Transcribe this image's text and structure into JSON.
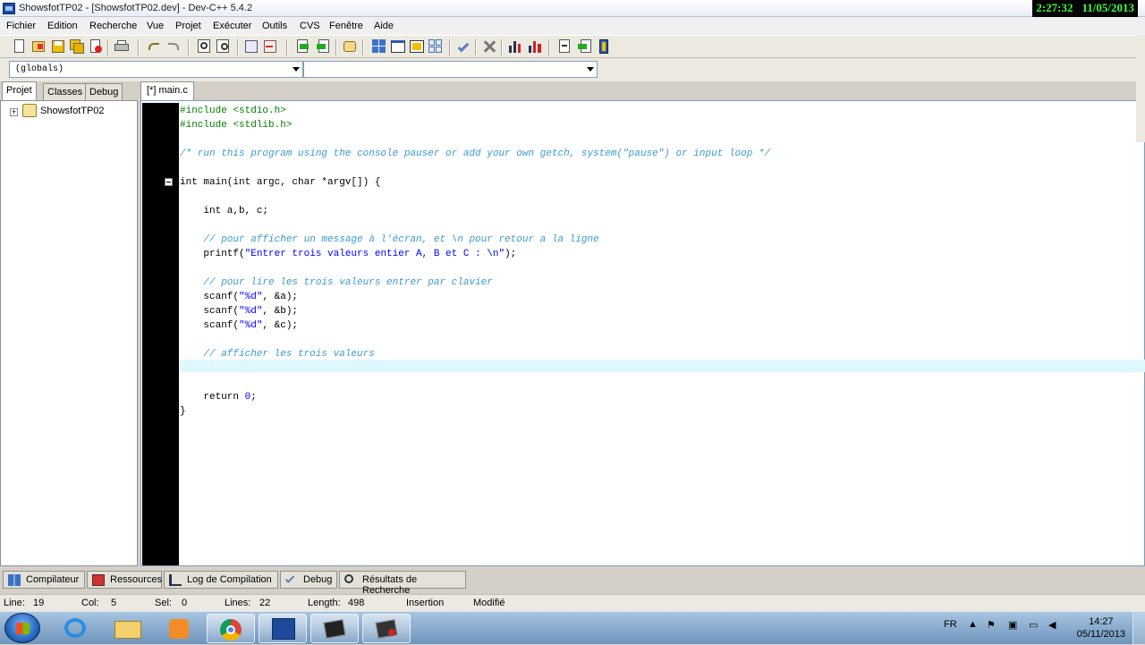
{
  "window": {
    "title": "ShowsfotTP02 - [ShowsfotTP02.dev] - Dev-C++ 5.4.2"
  },
  "clock_overlay": {
    "time": "2:27:32",
    "date": "11/05/2013"
  },
  "menu": [
    "Fichier",
    "Edition",
    "Recherche",
    "Vue",
    "Projet",
    "Exécuter",
    "Outils",
    "CVS",
    "Fenêtre",
    "Aide"
  ],
  "combos": {
    "scope": "(globals)",
    "member": ""
  },
  "left_tabs": [
    "Projet",
    "Classes",
    "Debug"
  ],
  "project_tree": {
    "root": "ShowsfotTP02"
  },
  "editor_tab": "[*] main.c",
  "code": [
    {
      "t": "pp",
      "text": "#include <stdio.h>"
    },
    {
      "t": "pp",
      "text": "#include <stdlib.h>"
    },
    {
      "t": "",
      "text": ""
    },
    {
      "t": "cm",
      "text": "/* run this program using the console pauser or add your own getch, system(\"pause\") or input loop */"
    },
    {
      "t": "",
      "text": ""
    },
    {
      "t": "",
      "text": "int main(int argc, char *argv[]) {"
    },
    {
      "t": "",
      "text": ""
    },
    {
      "t": "",
      "text": "    int a,b, c;"
    },
    {
      "t": "",
      "text": ""
    },
    {
      "t": "cm",
      "text": "    // pour afficher un message à l'écran, et \\n pour retour a la ligne"
    },
    {
      "t": "str",
      "pre": "    printf(",
      "s": "\"Entrer trois valeurs entier A, B et C : \\n\"",
      "post": ");"
    },
    {
      "t": "",
      "text": ""
    },
    {
      "t": "cm",
      "text": "    // pour lire les trois valeurs entrer par clavier"
    },
    {
      "t": "str",
      "pre": "    scanf(",
      "s": "\"%d\"",
      "post": ", &a);"
    },
    {
      "t": "str",
      "pre": "    scanf(",
      "s": "\"%d\"",
      "post": ", &b);"
    },
    {
      "t": "str",
      "pre": "    scanf(",
      "s": "\"%d\"",
      "post": ", &c);"
    },
    {
      "t": "",
      "text": ""
    },
    {
      "t": "cm",
      "text": "    // afficher les trois valeurs"
    },
    {
      "t": "",
      "text": ""
    },
    {
      "t": "",
      "text": ""
    },
    {
      "t": "str",
      "pre": "    return ",
      "s": "0",
      "post": ";"
    },
    {
      "t": "",
      "text": "}"
    }
  ],
  "bottom_tabs": [
    "Compilateur",
    "Ressources",
    "Log de Compilation",
    "Debug",
    "Résultats de Recherche"
  ],
  "status": {
    "line_label": "Line:",
    "line": "19",
    "col_label": "Col:",
    "col": "5",
    "sel_label": "Sel:",
    "sel": "0",
    "lines_label": "Lines:",
    "lines": "22",
    "length_label": "Length:",
    "length": "498",
    "mode": "Insertion",
    "modified": "Modifié"
  },
  "taskbar": {
    "lang": "FR",
    "time": "14:27",
    "date": "05/11/2013"
  },
  "icons": [
    "new-file-icon",
    "open-icon",
    "save-icon",
    "save-all-icon",
    "close-icon",
    "print-icon",
    "undo-icon",
    "redo-icon",
    "find-icon",
    "replace-icon",
    "indent-icon",
    "unindent-icon",
    "add-to-project-icon",
    "remove-from-project-icon",
    "class-icon",
    "compile-icon",
    "run-icon",
    "compile-run-icon",
    "rebuild-icon",
    "check-icon",
    "stop-icon",
    "profile-icon",
    "delete-profile-icon",
    "goto-icon",
    "next-icon",
    "bookmark-icon"
  ],
  "colors": {
    "preprocessor": "#008000",
    "comment": "#3b9ad1",
    "string": "#0000ff",
    "gutter": "#000000",
    "current_line": "#dff7ff"
  }
}
